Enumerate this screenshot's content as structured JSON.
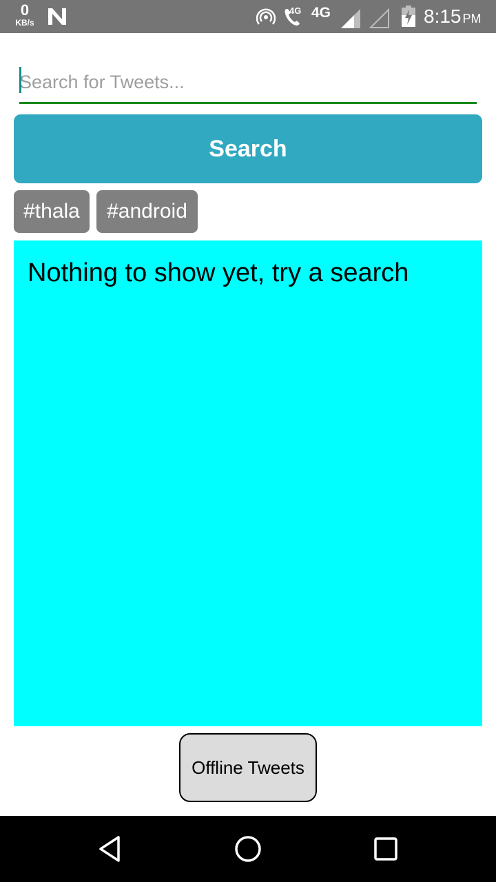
{
  "status_bar": {
    "data_rate": "0",
    "data_rate_unit": "KB/s",
    "network_small": "4G",
    "network": "4G",
    "time": "8:15",
    "ampm": "PM"
  },
  "search": {
    "placeholder": "Search for Tweets...",
    "value": "",
    "button_label": "Search"
  },
  "hashtags": [
    "#thala",
    "#android"
  ],
  "results": {
    "empty_message": "Nothing to show yet, try a search",
    "background": "#00ffff"
  },
  "offline_button_label": "Offline Tweets",
  "colors": {
    "accent": "#30a9c1",
    "underline": "#1b8a1b",
    "tag": "#808080"
  },
  "icons": [
    "n-icon",
    "hotspot-icon",
    "call-icon",
    "signal-icon",
    "battery-icon",
    "back-icon",
    "home-icon",
    "recents-icon"
  ]
}
